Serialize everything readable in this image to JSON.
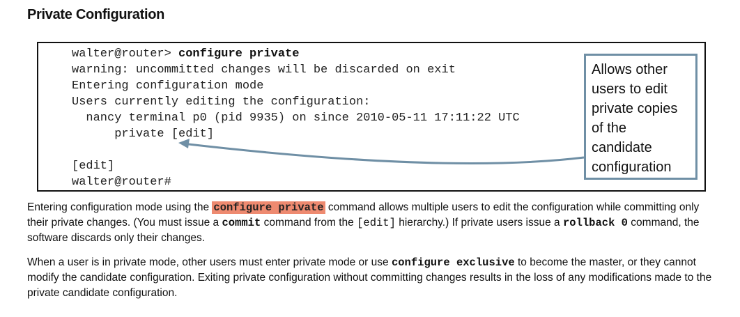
{
  "title": "Private Configuration",
  "terminal": {
    "l1_prompt": "walter@router> ",
    "l1_cmd": "configure private",
    "l2": "warning: uncommitted changes will be discarded on exit",
    "l3": "Entering configuration mode",
    "l4": "Users currently editing the configuration:",
    "l5": "  nancy terminal p0 (pid 9935) on since 2010-05-11 17:11:22 UTC",
    "l6": "      private [edit]",
    "l7": "[edit]",
    "l8": "walter@router#"
  },
  "callout": "Allows other users to edit private copies of the candidate configuration",
  "para1": {
    "t1": "Entering configuration mode using the ",
    "c1": "configure private",
    "t2": " command allows multiple users to edit the configuration while committing only their private changes. (You must issue a ",
    "c2": "commit",
    "t3": " command from the ",
    "c3": "[edit]",
    "t4": " hierarchy.) If private users issue a ",
    "c4": "rollback 0",
    "t5": " command, the software discards only their changes."
  },
  "para2": {
    "t1": "When a user is in private mode, other users must enter private mode or use ",
    "c1": "configure exclusive",
    "t2": " to become the master, or they cannot modify the candidate configuration. Exiting private configuration without committing changes results in the loss of any modifications made to the private candidate configuration."
  },
  "colors": {
    "highlight": "#ee8a70",
    "callout_border": "#6f8fa5",
    "arrow": "#6f8fa5"
  }
}
